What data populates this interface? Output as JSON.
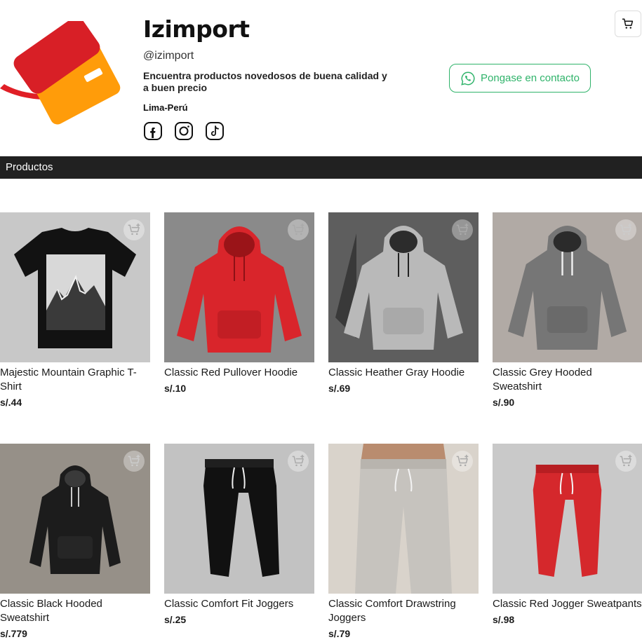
{
  "header": {
    "shop_name": "Izimport",
    "handle": "@izimport",
    "tagline": "Encuentra productos novedosos de buena calidad y a buen precio",
    "location": "Lima-Perú",
    "socials": [
      "facebook-icon",
      "instagram-icon",
      "tiktok-icon"
    ],
    "contact_label": "Pongase en contacto",
    "accent_color": "#2fb36a"
  },
  "section": {
    "title": "Productos"
  },
  "products": [
    {
      "name": "Majestic Mountain Graphic T-Shirt",
      "price": "s/.44"
    },
    {
      "name": "Classic Red Pullover Hoodie",
      "price": "s/.10"
    },
    {
      "name": "Classic Heather Gray Hoodie",
      "price": "s/.69"
    },
    {
      "name": "Classic Grey Hooded Sweatshirt",
      "price": "s/.90"
    },
    {
      "name": "Classic Black Hooded Sweatshirt",
      "price": "s/.779"
    },
    {
      "name": "Classic Comfort Fit Joggers",
      "price": "s/.25"
    },
    {
      "name": "Classic Comfort Drawstring Joggers",
      "price": "s/.79"
    },
    {
      "name": "Classic Red Jogger Sweatpants",
      "price": "s/.98"
    }
  ]
}
